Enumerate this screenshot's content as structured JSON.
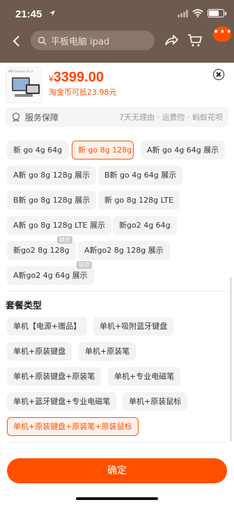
{
  "status_bar": {
    "time": "21:45"
  },
  "nav": {
    "back_icon": "chevron-left-icon",
    "search_placeholder": "平板电脑 ipad",
    "more_label": "•••"
  },
  "product": {
    "currency": "¥",
    "price": "3399.00",
    "coin_note": "淘金币可抵23.98元",
    "thumb_caption": "WiFi Surface Go 2"
  },
  "service": {
    "title": "服务保障",
    "detail": "7天无理由 · 运费险 · 蚂蚁花呗"
  },
  "variants": [
    {
      "label": "新 go 4g 64g",
      "selected": false
    },
    {
      "label": "新 go 8g 128g",
      "selected": true
    },
    {
      "label": "A新 go 4g 64g 展示",
      "selected": false
    },
    {
      "label": "A新 go 8g 128g 展示",
      "selected": false
    },
    {
      "label": "B新 go 4g 64g 展示",
      "selected": false
    },
    {
      "label": "B新 go 8g 128g 展示",
      "selected": false
    },
    {
      "label": "新 go 8g 128g LTE",
      "selected": false
    },
    {
      "label": "A新 go 8g 128g LTE 展示",
      "selected": false
    },
    {
      "label": "新go2 4g 64g",
      "selected": false
    },
    {
      "label": "新go2 8g 128g",
      "selected": false,
      "badge": "缺货"
    },
    {
      "label": "A新go2 8g 128g 展示",
      "selected": false
    },
    {
      "label": "A新go2 4g 64g 展示",
      "selected": false,
      "badge": "缺货"
    }
  ],
  "package_section": {
    "title": "套餐类型"
  },
  "packages": [
    {
      "label": "单机【电源+赠品】",
      "selected": false
    },
    {
      "label": "单机+吸附蓝牙键盘",
      "selected": false
    },
    {
      "label": "单机+原装键盘",
      "selected": false
    },
    {
      "label": "单机+原装笔",
      "selected": false
    },
    {
      "label": "单机+原装键盘+原装笔",
      "selected": false
    },
    {
      "label": "单机+专业电磁笔",
      "selected": false
    },
    {
      "label": "单机+蓝牙键盘+专业电磁笔",
      "selected": false
    },
    {
      "label": "单机+原装鼠标",
      "selected": false
    },
    {
      "label": "单机+原装键盘+原装笔+原装鼠标",
      "selected": true
    }
  ],
  "confirm_label": "确定",
  "colors": {
    "accent": "#ff5000",
    "price": "#ff4400",
    "chip_bg": "#f3f3f3"
  }
}
